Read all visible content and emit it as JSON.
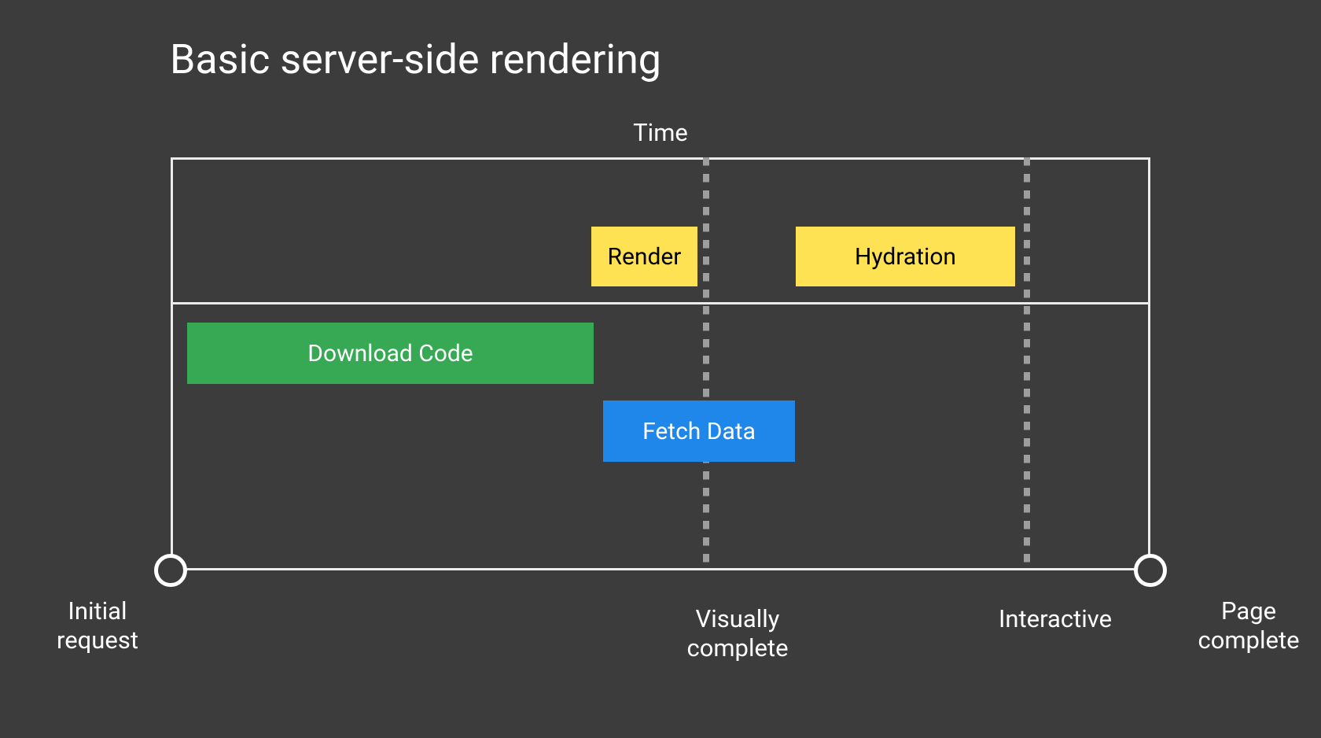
{
  "title": "Basic server-side rendering",
  "axis": {
    "top": "Time"
  },
  "bars": {
    "render": "Render",
    "hydration": "Hydration",
    "downloadCode": "Download Code",
    "fetchData": "Fetch Data"
  },
  "labels": {
    "initialRequest": "Initial request",
    "visuallyComplete": "Visually complete",
    "interactive": "Interactive",
    "pageComplete": "Page complete"
  },
  "chart_data": {
    "type": "gantt-timeline",
    "title": "Basic server-side rendering",
    "xlabel": "Time",
    "milestones": [
      {
        "name": "Initial request",
        "position": 0
      },
      {
        "name": "Visually complete",
        "position": 55
      },
      {
        "name": "Interactive",
        "position": 87
      },
      {
        "name": "Page complete",
        "position": 100
      }
    ],
    "tracks": [
      {
        "lane": "client-render",
        "bars": [
          {
            "label": "Render",
            "start": 43,
            "end": 54,
            "color": "#ffe254"
          },
          {
            "label": "Hydration",
            "start": 64,
            "end": 86,
            "color": "#ffe254"
          }
        ]
      },
      {
        "lane": "download",
        "bars": [
          {
            "label": "Download Code",
            "start": 2,
            "end": 43,
            "color": "#37a954"
          }
        ]
      },
      {
        "lane": "data",
        "bars": [
          {
            "label": "Fetch Data",
            "start": 44,
            "end": 64,
            "color": "#1f87e9"
          }
        ]
      }
    ]
  }
}
